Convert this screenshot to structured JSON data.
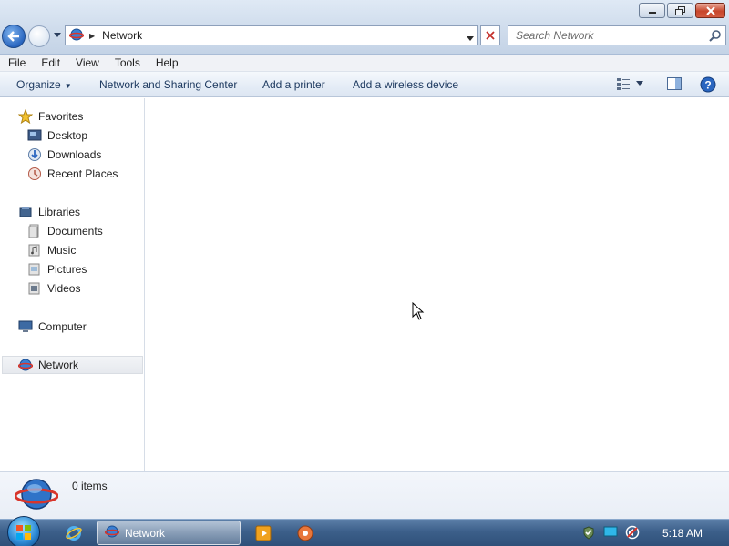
{
  "window": {
    "title_buttons": [
      "minimize",
      "maximize",
      "close"
    ]
  },
  "address_bar": {
    "location": "Network",
    "icon": "network-icon"
  },
  "search": {
    "placeholder": "Search Network"
  },
  "menu": {
    "items": [
      "File",
      "Edit",
      "View",
      "Tools",
      "Help"
    ]
  },
  "command_bar": {
    "organize": "Organize",
    "items": [
      "Network and Sharing Center",
      "Add a printer",
      "Add a wireless device"
    ]
  },
  "navigation": {
    "favorites": {
      "label": "Favorites",
      "items": [
        "Desktop",
        "Downloads",
        "Recent Places"
      ]
    },
    "libraries": {
      "label": "Libraries",
      "items": [
        "Documents",
        "Music",
        "Pictures",
        "Videos"
      ]
    },
    "computer": "Computer",
    "network": "Network",
    "selected": "Network"
  },
  "details": {
    "item_count": "0 items"
  },
  "taskbar": {
    "active_task": "Network",
    "clock": "5:18 AM"
  },
  "colors": {
    "accent": "#2a66c0",
    "taskbar": "#3c5f8a"
  }
}
